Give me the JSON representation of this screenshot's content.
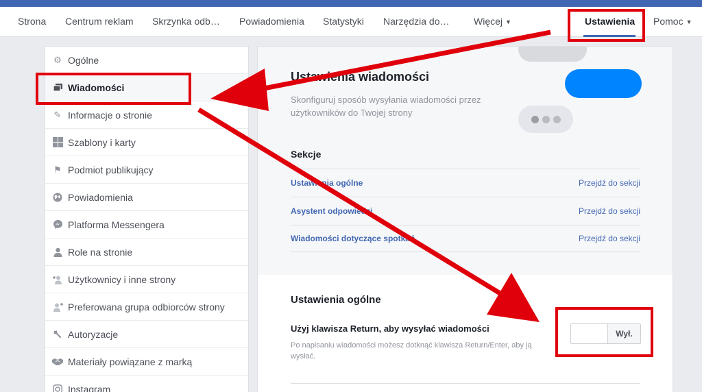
{
  "topnav": {
    "items": [
      "Strona",
      "Centrum reklam",
      "Skrzynka odb…",
      "Powiadomienia",
      "Statystyki",
      "Narzędzia do…",
      "Więcej",
      "Ustawienia",
      "Pomoc"
    ]
  },
  "sidebar": {
    "items": [
      {
        "label": "Ogólne",
        "icon": "gear-icon"
      },
      {
        "label": "Wiadomości",
        "icon": "messages-icon"
      },
      {
        "label": "Informacje o stronie",
        "icon": "pencil-icon"
      },
      {
        "label": "Szablony i karty",
        "icon": "grid-icon"
      },
      {
        "label": "Podmiot publikujący",
        "icon": "flag-icon"
      },
      {
        "label": "Powiadomienia",
        "icon": "globe-icon"
      },
      {
        "label": "Platforma Messengera",
        "icon": "messenger-icon"
      },
      {
        "label": "Role na stronie",
        "icon": "person-icon"
      },
      {
        "label": "Użytkownicy i inne strony",
        "icon": "person-plus-icon"
      },
      {
        "label": "Preferowana grupa odbiorców strony",
        "icon": "person-star-icon"
      },
      {
        "label": "Autoryzacje",
        "icon": "wrench-icon"
      },
      {
        "label": "Materiały powiązane z marką",
        "icon": "handshake-icon"
      },
      {
        "label": "Instagram",
        "icon": "instagram-icon"
      }
    ]
  },
  "main": {
    "title": "Ustawienia wiadomości",
    "description": "Skonfiguruj sposób wysyłania wiadomości przez użytkowników do Twojej strony",
    "sections_title": "Sekcje",
    "sections": [
      {
        "label": "Ustawienia ogólne",
        "action": "Przejdź do sekcji"
      },
      {
        "label": "Asystent odpowiedzi",
        "action": "Przejdź do sekcji"
      },
      {
        "label": "Wiadomości dotyczące spotkań",
        "action": "Przejdź do sekcji"
      }
    ],
    "general_title": "Ustawienia ogólne",
    "return_label": "Użyj klawisza Return, aby wysyłać wiadomości",
    "return_desc": "Po napisaniu wiadomości możesz dotknąć klawisza Return/Enter, aby ją wysłać.",
    "toggle_off": "Wył.",
    "toggle_value": "off"
  },
  "colors": {
    "accent": "#4267b2",
    "annotation_red": "#e0000b",
    "messenger_blue": "#0084ff"
  }
}
